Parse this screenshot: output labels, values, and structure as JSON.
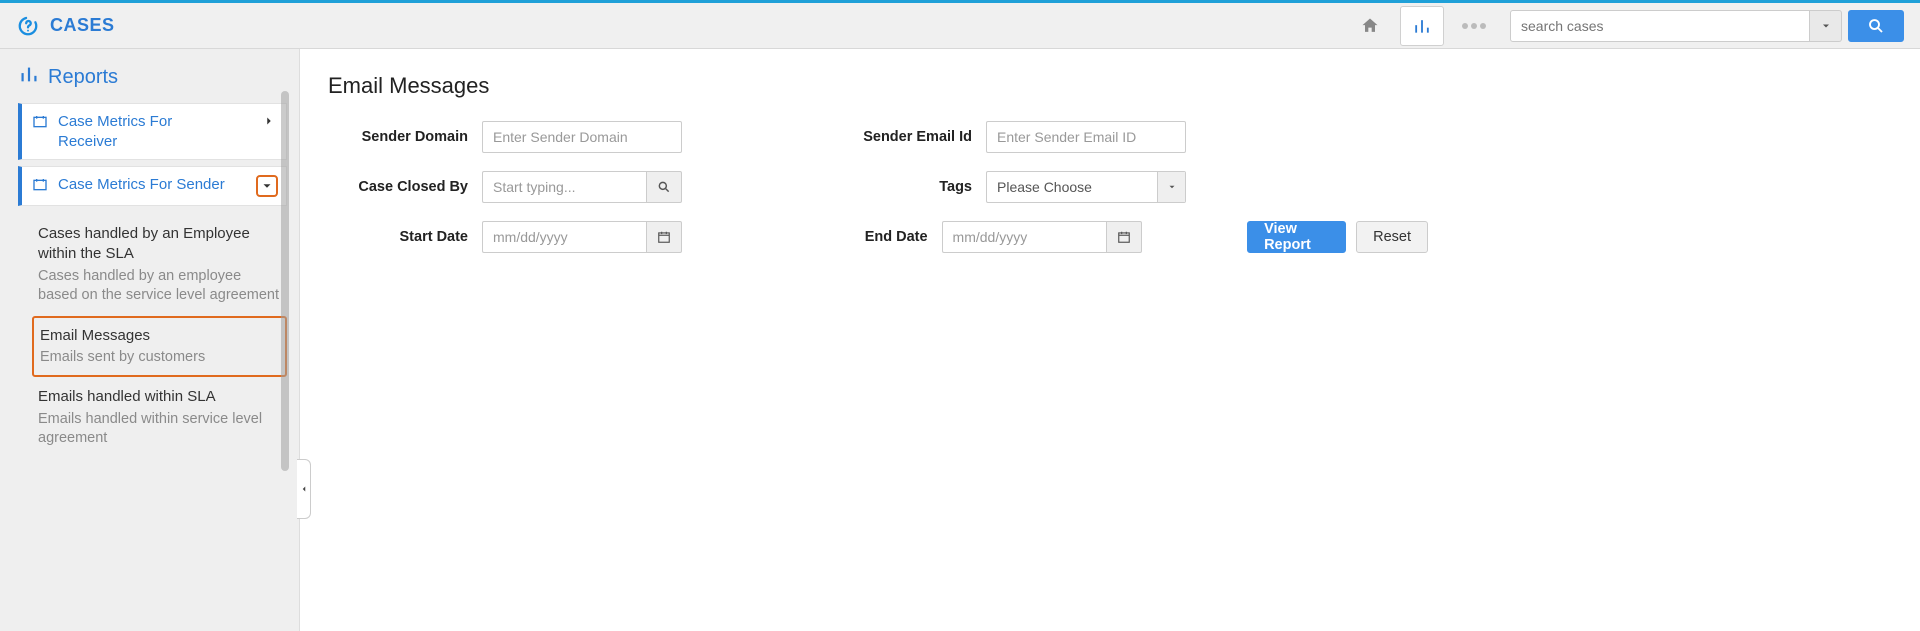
{
  "header": {
    "app_title": "CASES",
    "search_placeholder": "search cases"
  },
  "sidebar": {
    "heading": "Reports",
    "items": [
      {
        "label": "Case Metrics For Receiver"
      },
      {
        "label": "Case Metrics For Sender"
      }
    ],
    "sub_items": [
      {
        "title": "Cases handled by an Employee within the SLA",
        "desc": "Cases handled by an employee based on the service level agreement"
      },
      {
        "title": "Email Messages",
        "desc": "Emails sent by customers"
      },
      {
        "title": "Emails handled within SLA",
        "desc": "Emails handled within service level agreement"
      }
    ]
  },
  "page": {
    "title": "Email Messages",
    "labels": {
      "sender_domain": "Sender Domain",
      "sender_email": "Sender Email Id",
      "case_closed_by": "Case Closed By",
      "tags": "Tags",
      "start_date": "Start Date",
      "end_date": "End Date"
    },
    "placeholders": {
      "sender_domain": "Enter Sender Domain",
      "sender_email": "Enter Sender Email ID",
      "case_closed_by": "Start typing...",
      "tags": "Please Choose",
      "date": "mm/dd/yyyy"
    },
    "buttons": {
      "view_report": "View Report",
      "reset": "Reset"
    }
  }
}
